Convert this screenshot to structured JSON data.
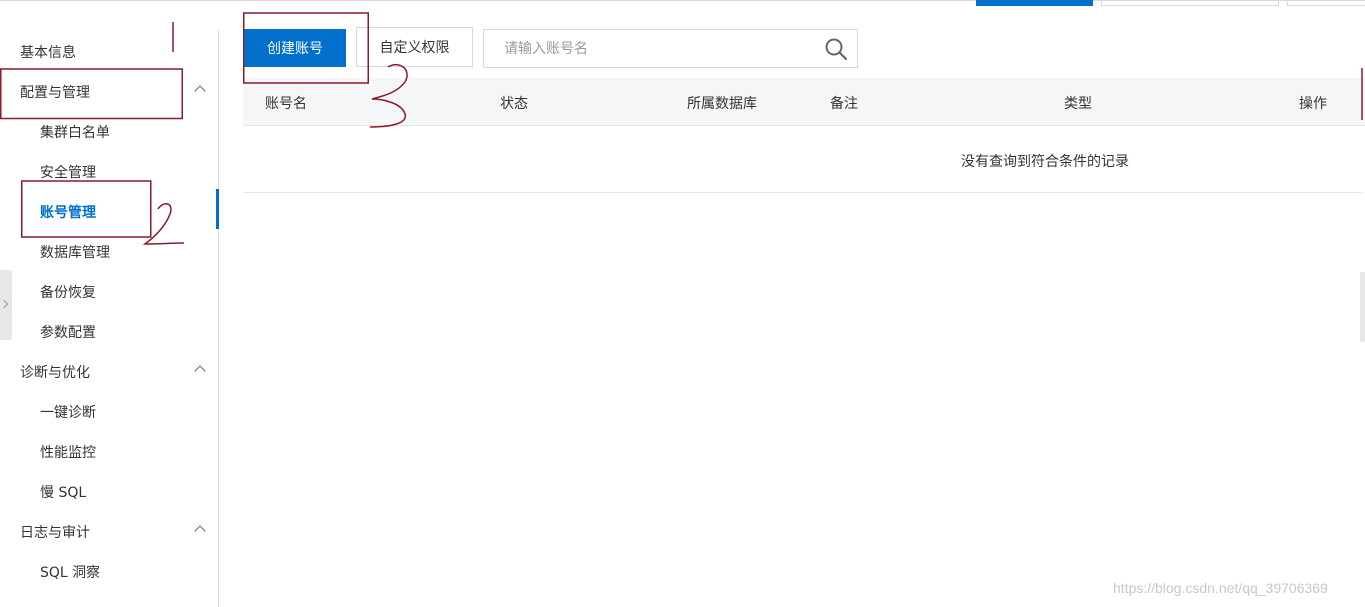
{
  "toolbar": {
    "create_label": "创建账号",
    "custom_label": "自定义权限",
    "search_placeholder": "请输入账号名"
  },
  "sidebar": {
    "items": [
      {
        "label": "基本信息",
        "level": "top"
      },
      {
        "label": "配置与管理",
        "level": "top",
        "expanded": true
      },
      {
        "label": "集群白名单",
        "level": "sub"
      },
      {
        "label": "安全管理",
        "level": "sub"
      },
      {
        "label": "账号管理",
        "level": "sub",
        "active": true
      },
      {
        "label": "数据库管理",
        "level": "sub"
      },
      {
        "label": "备份恢复",
        "level": "sub"
      },
      {
        "label": "参数配置",
        "level": "sub"
      },
      {
        "label": "诊断与优化",
        "level": "top",
        "expanded": true
      },
      {
        "label": "一键诊断",
        "level": "sub"
      },
      {
        "label": "性能监控",
        "level": "sub"
      },
      {
        "label": "慢 SQL",
        "level": "sub"
      },
      {
        "label": "日志与审计",
        "level": "top",
        "expanded": true
      },
      {
        "label": "SQL 洞察",
        "level": "sub"
      }
    ]
  },
  "table": {
    "columns": [
      "账号名",
      "状态",
      "所属数据库",
      "备注",
      "类型",
      "操作"
    ],
    "empty_text": "没有查询到符合条件的记录"
  },
  "colors": {
    "primary": "#0070cc",
    "annotation": "#8b1a2b"
  },
  "icons": {
    "search": "search-icon",
    "chevron": "chevron-up-icon"
  },
  "annotations": [
    "2",
    "3"
  ],
  "watermark": "https://blog.csdn.net/qq_39706369"
}
